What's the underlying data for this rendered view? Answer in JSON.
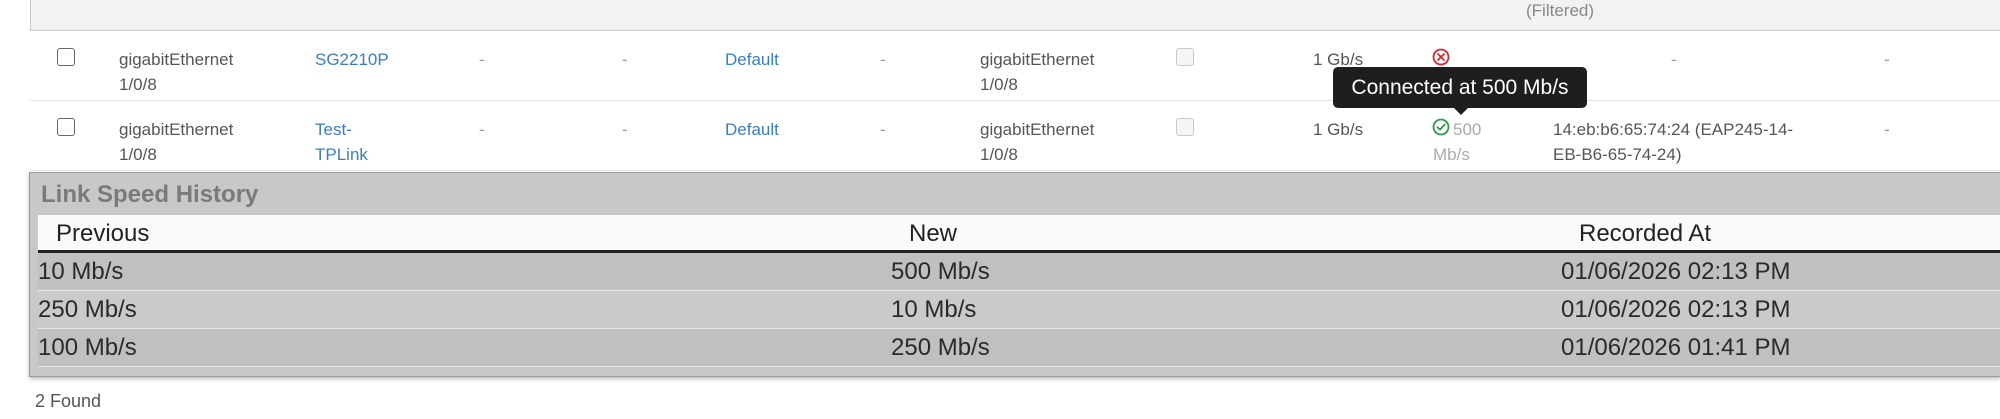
{
  "table": {
    "filtered_label": "(Filtered)",
    "rows": [
      {
        "interface": [
          "gigabitEthernet",
          "1/0/8"
        ],
        "device": [
          "SG2210P"
        ],
        "col3": "-",
        "col4": "-",
        "profile": "Default",
        "col6": "-",
        "remote_interface": [
          "gigabitEthernet",
          "1/0/8"
        ],
        "configured_speed": "1 Gb/s",
        "status": "disconnected",
        "link_speed": [
          "",
          ""
        ],
        "neighbor": [
          "-",
          ""
        ],
        "last": "-"
      },
      {
        "interface": [
          "gigabitEthernet",
          "1/0/8"
        ],
        "device": [
          "Test-",
          "TPLink"
        ],
        "col3": "-",
        "col4": "-",
        "profile": "Default",
        "col6": "-",
        "remote_interface": [
          "gigabitEthernet",
          "1/0/8"
        ],
        "configured_speed": "1 Gb/s",
        "status": "connected",
        "link_speed": [
          "500",
          "Mb/s"
        ],
        "neighbor": [
          "14:eb:b6:65:74:24 (EAP245-14-",
          "EB-B6-65-74-24)"
        ],
        "last": "-"
      }
    ]
  },
  "tooltip": {
    "text": "Connected at 500 Mb/s"
  },
  "history": {
    "title": "Link Speed History",
    "headers": {
      "previous": "Previous",
      "new": "New",
      "recorded_at": "Recorded At"
    },
    "rows": [
      {
        "previous": "10 Mb/s",
        "new": "500 Mb/s",
        "recorded_at": "01/06/2026 02:13 PM"
      },
      {
        "previous": "250 Mb/s",
        "new": "10 Mb/s",
        "recorded_at": "01/06/2026 02:13 PM"
      },
      {
        "previous": "100 Mb/s",
        "new": "250 Mb/s",
        "recorded_at": "01/06/2026 01:41 PM"
      }
    ]
  },
  "footer": {
    "count_text": "2 Found"
  },
  "colors": {
    "link": "#3a7dc0",
    "connected": "#2e9a4a",
    "disconnected": "#d9262c"
  },
  "icons": {
    "connected": "check-circle-icon",
    "disconnected": "x-circle-icon"
  }
}
